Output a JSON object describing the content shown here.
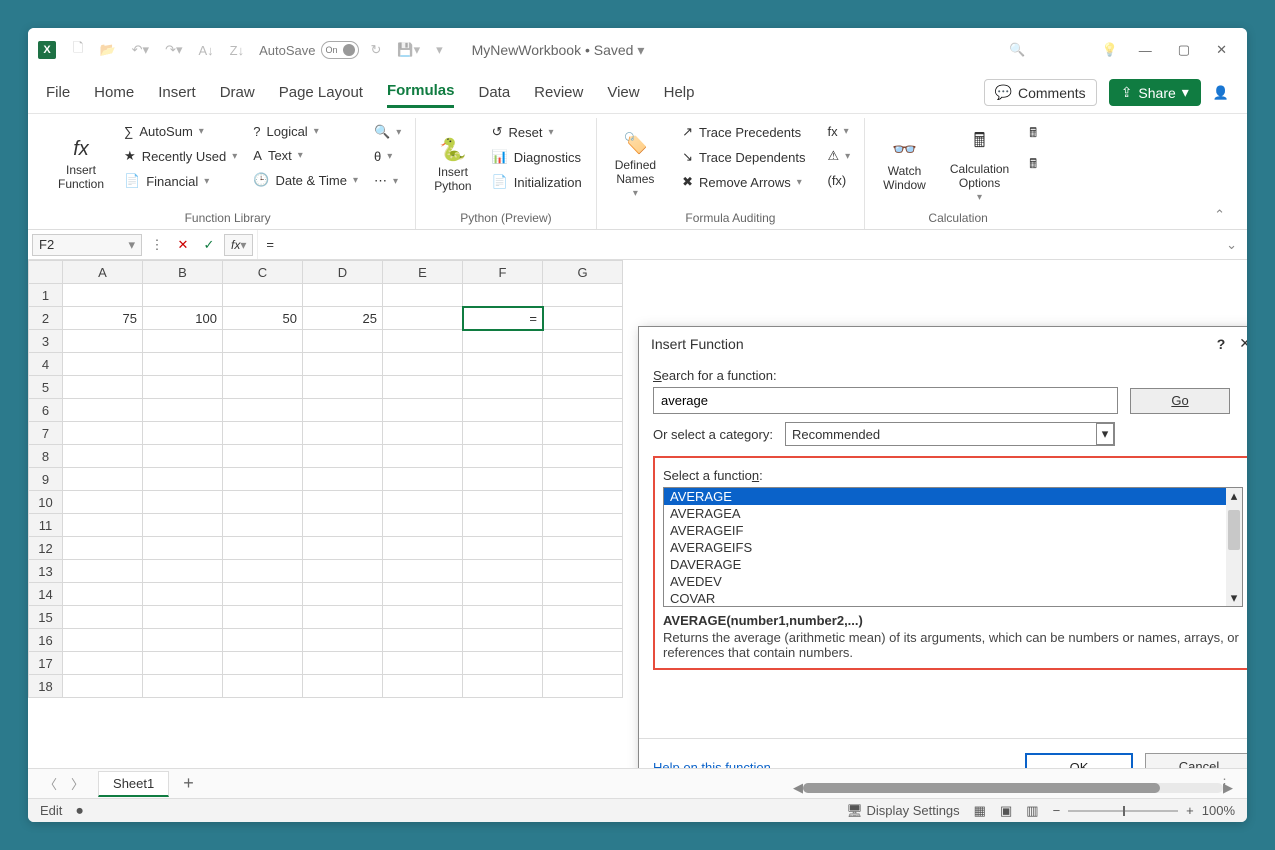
{
  "titlebar": {
    "autosave_label": "AutoSave",
    "autosave_state": "On",
    "doc_name": "MyNewWorkbook",
    "doc_status": "Saved"
  },
  "menubar": {
    "tabs": [
      "File",
      "Home",
      "Insert",
      "Draw",
      "Page Layout",
      "Formulas",
      "Data",
      "Review",
      "View",
      "Help"
    ],
    "active_index": 5,
    "comments_label": "Comments",
    "share_label": "Share"
  },
  "ribbon": {
    "group_function_library": "Function Library",
    "group_python": "Python (Preview)",
    "group_auditing": "Formula Auditing",
    "group_calculation": "Calculation",
    "btn_insert_function": "Insert\nFunction",
    "btn_autosum": "AutoSum",
    "btn_recent": "Recently Used",
    "btn_financial": "Financial",
    "btn_logical": "Logical",
    "btn_text": "Text",
    "btn_datetime": "Date & Time",
    "btn_insert_python": "Insert\nPython",
    "btn_reset": "Reset",
    "btn_diag": "Diagnostics",
    "btn_init": "Initialization",
    "btn_defined_names": "Defined\nNames",
    "btn_trace_prec": "Trace Precedents",
    "btn_trace_dep": "Trace Dependents",
    "btn_remove_arrows": "Remove Arrows",
    "btn_watch": "Watch\nWindow",
    "btn_calc_opts": "Calculation\nOptions"
  },
  "formula_bar": {
    "name_box": "F2",
    "formula": "="
  },
  "grid": {
    "columns": [
      "A",
      "B",
      "C",
      "D",
      "E",
      "F",
      "G"
    ],
    "row_count": 18,
    "active_cell": "F2",
    "active_cell_value": "=",
    "data": {
      "A2": "75",
      "B2": "100",
      "C2": "50",
      "D2": "25"
    }
  },
  "dialog": {
    "title": "Insert Function",
    "search_label": "Search for a function:",
    "search_value": "average",
    "go_label": "Go",
    "category_label": "Or select a category:",
    "category_value": "Recommended",
    "select_fn_label": "Select a function:",
    "functions": [
      "AVERAGE",
      "AVERAGEA",
      "AVERAGEIF",
      "AVERAGEIFS",
      "DAVERAGE",
      "AVEDEV",
      "COVAR"
    ],
    "selected_index": 0,
    "signature": "AVERAGE(number1,number2,...)",
    "description": "Returns the average (arithmetic mean) of its arguments, which can be numbers or names, arrays, or references that contain numbers.",
    "help_link": "Help on this function",
    "ok_label": "OK",
    "cancel_label": "Cancel"
  },
  "sheet_tabs": {
    "tabs": [
      "Sheet1"
    ],
    "active_index": 0
  },
  "statusbar": {
    "mode": "Edit",
    "display_settings": "Display Settings",
    "zoom": "100%"
  }
}
